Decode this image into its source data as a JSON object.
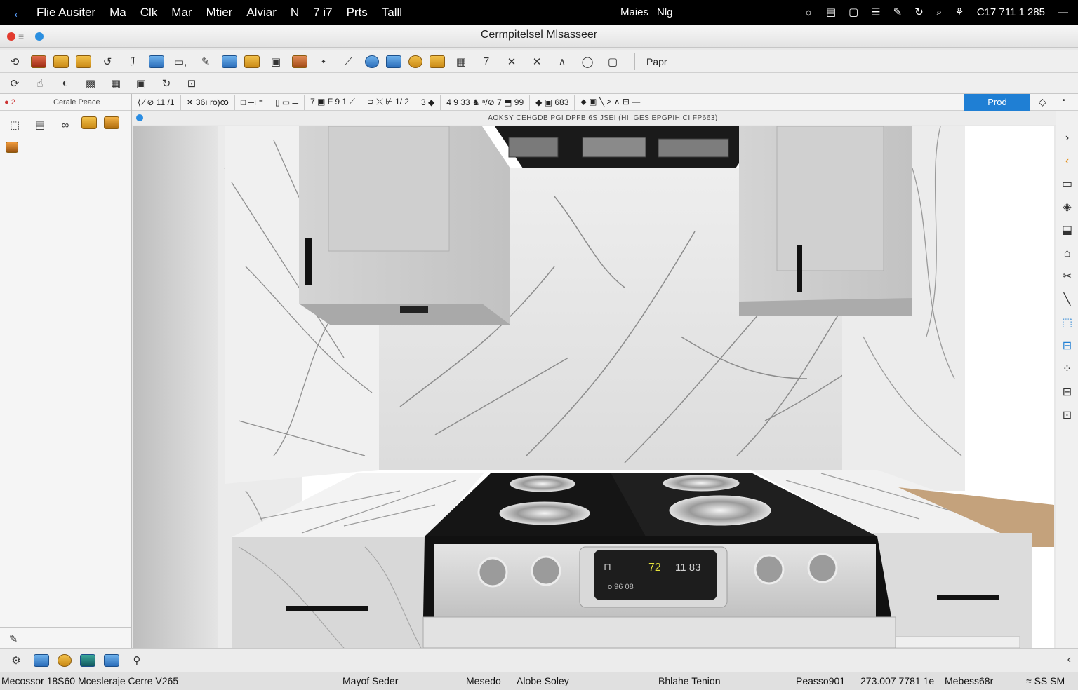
{
  "menubar": {
    "items": [
      "Flie Ausiter",
      "Ma",
      "Clk",
      "Mar",
      "Mtier",
      "Alviar",
      "N",
      "7 i7",
      "Prts",
      "Talll"
    ],
    "center": [
      "Maies",
      "Nlg"
    ],
    "clock": "C17 711 1 285"
  },
  "window": {
    "title": "Cermpitelsel Mlsasseer"
  },
  "toolbar": {
    "paper_label": "Papr"
  },
  "left_panel": {
    "header_left": "2",
    "header_right": "Cerale Peace"
  },
  "draw_bar": {
    "groups": [
      "⟨ ⁄ ⊘ 11 /1",
      "✕ 36ı ro)ꝏ",
      "□ ─ı ⁼",
      "▯ ▭ ═",
      "7 ▣ F 9 1 ⟋",
      "⊃ ⤫ ⊬ 1/ 2",
      "3 ◆",
      "4 9 33 ♞ ⁿ/⊘ 7 ⬒ 99",
      "◆ ▣ 683",
      "⬥ ▣ ╲ > ∧ ⊟ ―"
    ],
    "active_tab": "Prod"
  },
  "info_bar": {
    "message": "AOKSY CEHGDB PGI DPFB 6S JSEI (HI. GES EPGPIH   CI FP663)"
  },
  "stove_display": {
    "left": "⊓",
    "temp": "72",
    "right": "11 83",
    "sub": "o  96  08"
  },
  "status_bar": {
    "left": "Mecossor 18S60  Mcesleraje Cerre V265",
    "mid1": "Mayof Seder",
    "mid2": "Mesedo",
    "mid3": "Alobe Soley",
    "mid4": "Bhlahe Tenion",
    "r1": "Peasso901",
    "r2": "273.007 7781 1e",
    "r3": "Mebess68r",
    "r4": "≈ SS SM"
  },
  "colors": {
    "accent": "#1f7fd4",
    "menubar": "#000000",
    "marble": "#e9e9e9",
    "cooktop": "#141414"
  }
}
